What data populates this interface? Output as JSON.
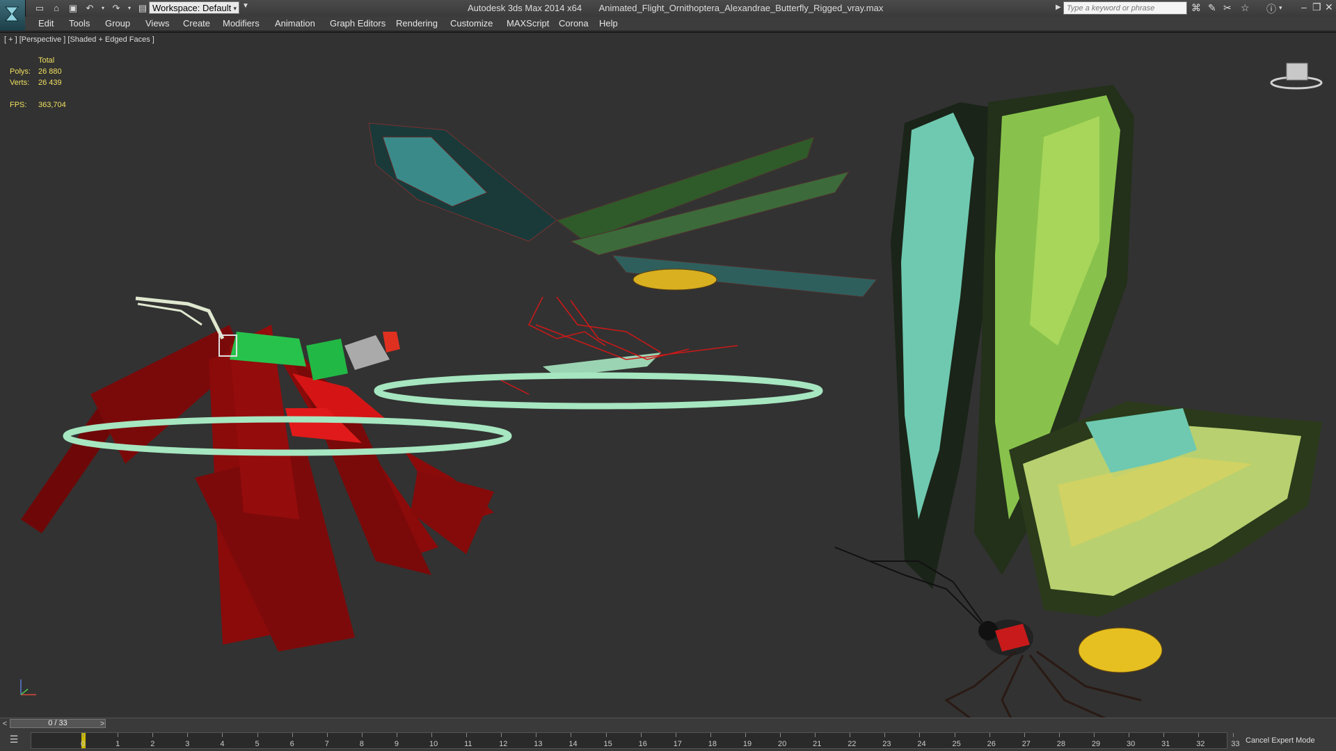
{
  "titlebar": {
    "workspace": "Workspace: Default",
    "app_title": "Autodesk 3ds Max  2014 x64",
    "file_name": "Animated_Flight_Ornithoptera_Alexandrae_Butterfly_Rigged_vray.max",
    "search_placeholder": "Type a keyword or phrase"
  },
  "menu": [
    "Edit",
    "Tools",
    "Group",
    "Views",
    "Create",
    "Modifiers",
    "Animation",
    "Graph Editors",
    "Rendering",
    "Customize",
    "MAXScript",
    "Corona",
    "Help"
  ],
  "viewport": {
    "label": "[ + ] [Perspective ] [Shaded + Edged Faces ]",
    "stats": {
      "total_label": "Total",
      "polys_label": "Polys:",
      "polys_value": "26 880",
      "verts_label": "Verts:",
      "verts_value": "26 439",
      "fps_label": "FPS:",
      "fps_value": "363,704"
    }
  },
  "timeline": {
    "slider_text": "0 / 33",
    "prev_label": "<",
    "next_label": ">",
    "ticks": [
      "0",
      "1",
      "2",
      "3",
      "4",
      "5",
      "6",
      "7",
      "8",
      "9",
      "10",
      "11",
      "12",
      "13",
      "14",
      "15",
      "16",
      "17",
      "18",
      "19",
      "20",
      "21",
      "22",
      "23",
      "24",
      "25",
      "26",
      "27",
      "28",
      "29",
      "30",
      "31",
      "32",
      "33"
    ],
    "current_frame": 0,
    "expert_mode": "Cancel Expert Mode"
  },
  "colors": {
    "wing_green": "#8fc85a",
    "wing_teal": "#5fc5b5",
    "rig_red": "#8b0a0a",
    "control_mint": "#a6e6c0",
    "body_yellow": "#e6c020"
  }
}
